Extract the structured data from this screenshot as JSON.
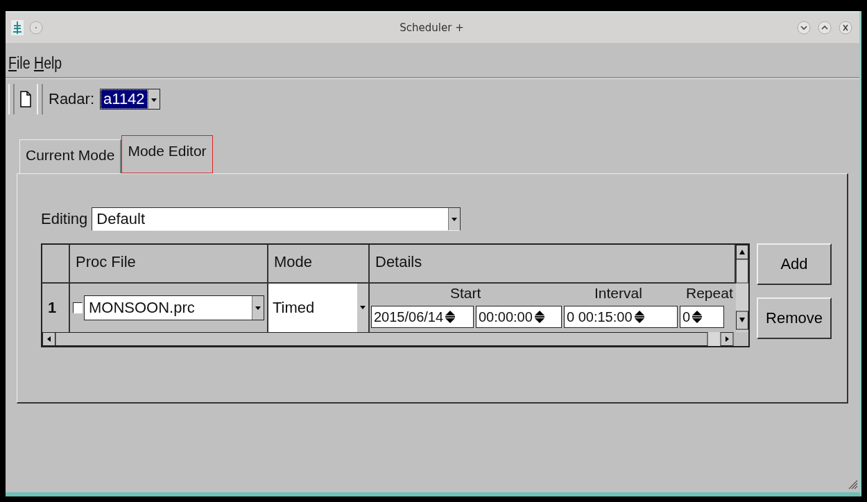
{
  "window": {
    "title": "Scheduler +"
  },
  "menu": [
    "File",
    "Help"
  ],
  "toolbar": {
    "radar_label": "Radar:",
    "radar_value": "a1142"
  },
  "tabs": [
    {
      "label": "Current Mode",
      "selected": false
    },
    {
      "label": "Mode Editor",
      "selected": true
    }
  ],
  "editing": {
    "label": "Editing",
    "value": "Default"
  },
  "table": {
    "columns": [
      "Proc File",
      "Mode",
      "Details"
    ],
    "detail_headers": [
      "Start",
      "Interval",
      "Repeat"
    ],
    "rows": [
      {
        "number": "1",
        "checked": false,
        "proc_file": "MONSOON.prc",
        "mode": "Timed",
        "start_date": "2015/06/14",
        "start_time": "00:00:00",
        "interval": "0 00:15:00",
        "repeat": "0"
      }
    ]
  },
  "buttons": [
    "Add",
    "Remove"
  ]
}
